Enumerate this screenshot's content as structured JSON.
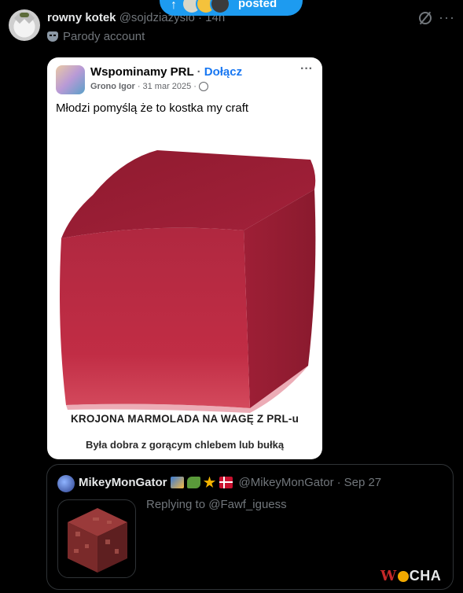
{
  "new_posts_pill": {
    "label": "posted",
    "arrow": "↑"
  },
  "tweet": {
    "author_name": "rowny kotek",
    "author_handle": "@sojdziazysio",
    "time": "14h",
    "parody_label": "Parody account",
    "more": "···"
  },
  "embedded_post": {
    "group_name": "Wspominamy PRL",
    "join": "Dołącz",
    "separator": "·",
    "poster": "Grono Igor",
    "date": "31 mar 2025",
    "text": "Młodzi pomyślą że to kostka my craft",
    "caption_line1": "KROJONA MARMOLADA NA WAGĘ Z PRL-u",
    "caption_line2": "Była dobra z gorącym chlebem lub bułką",
    "more": "···"
  },
  "quoted_tweet": {
    "author_name": "MikeyMonGator",
    "author_handle": "@MikeyMonGator",
    "date": "Sep 27",
    "reply_text": "Replying to @Fawf_iguess"
  },
  "watermark": {
    "w": "W",
    "rest": "CHA"
  },
  "colors": {
    "accent": "#1d9bf0",
    "background": "#000000",
    "muted": "#71767b",
    "jelly": "#b21f3a"
  }
}
